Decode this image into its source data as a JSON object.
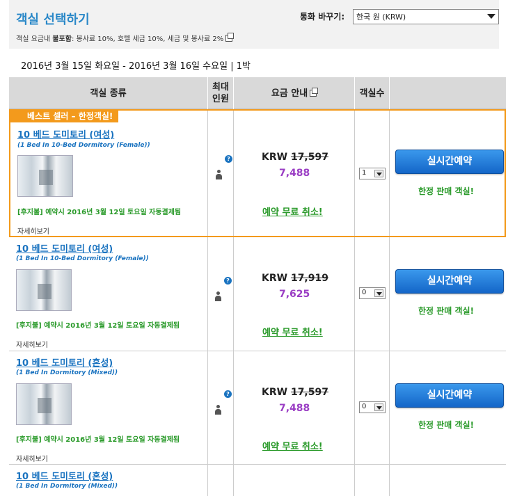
{
  "header": {
    "title": "객실 선택하기",
    "tax_note_prefix": "객실 요금내 ",
    "tax_note_bold": "불포함",
    "tax_note_rest": ": 봉사료 10%, 호텔 세금 10%, 세금 및 봉사료 2%",
    "currency_label": "통화 바꾸기:",
    "currency_value": "한국 원 (KRW)"
  },
  "dates": "2016년 3월 15일 화요일 - 2016년 3월 16일 수요일 | 1박",
  "columns": {
    "room_type": "객실 종류",
    "max_guests_1": "최대",
    "max_guests_2": "인원",
    "price_info": "요금 안내",
    "rooms": "객실수"
  },
  "best_badge": "베스트 셀러 – 한정객실!",
  "rooms": [
    {
      "name": "10 베드 도미토리 (여성)",
      "sub": "(1 Bed In 10-Bed Dormitory (Female))",
      "prepay": "[후지불] 예약시 2016년 3월 12일 토요일 자동결제됨",
      "detail": "자세히보기",
      "currency": "KRW",
      "old_price": "17,597",
      "new_price": "7,488",
      "cancel": "예약 무료 취소!",
      "qty": "1",
      "book": "실시간예약",
      "limited": "한정 판매 객실!"
    },
    {
      "name": "10 베드 도미토리 (여성)",
      "sub": "(1 Bed In 10-Bed Dormitory (Female))",
      "prepay": "[후지불] 예약시 2016년 3월 12일 토요일 자동결제됨",
      "detail": "자세히보기",
      "currency": "KRW",
      "old_price": "17,919",
      "new_price": "7,625",
      "cancel": "예약 무료 취소!",
      "qty": "0",
      "book": "실시간예약",
      "limited": "한정 판매 객실!"
    },
    {
      "name": "10 베드 도미토리 (혼성)",
      "sub": "(1 Bed In Dormitory (Mixed))",
      "prepay": "[후지불] 예약시 2016년 3월 12일 토요일 자동결제됨",
      "detail": "자세히보기",
      "currency": "KRW",
      "old_price": "17,597",
      "new_price": "7,488",
      "cancel": "예약 무료 취소!",
      "qty": "0",
      "book": "실시간예약",
      "limited": "한정 판매 객실!"
    },
    {
      "name": "10 베드 도미토리 (혼성)",
      "sub": "(1 Bed In Dormitory (Mixed))"
    }
  ]
}
